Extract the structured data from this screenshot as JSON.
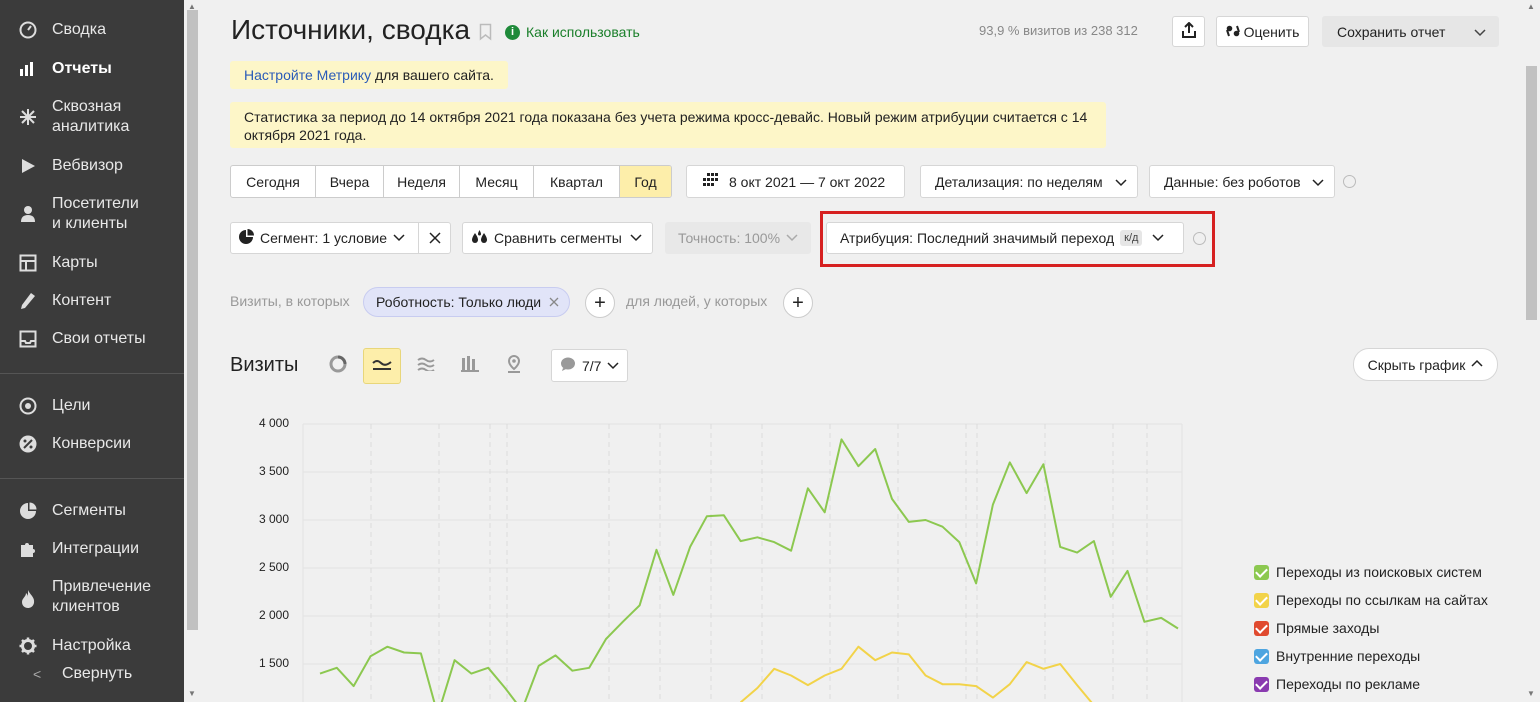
{
  "sidebar": {
    "items": [
      {
        "label": "Сводка",
        "icon": "dashboard-gauge-icon"
      },
      {
        "label": "Отчеты",
        "icon": "bar-chart-icon",
        "active": true
      },
      {
        "label": "Сквозная\nаналитика",
        "icon": "snowflake-icon"
      },
      {
        "label": "Вебвизор",
        "icon": "play-icon"
      },
      {
        "label": "Посетители\nи клиенты",
        "icon": "person-icon"
      },
      {
        "label": "Карты",
        "icon": "map-grid-icon"
      },
      {
        "label": "Контент",
        "icon": "pencil-icon"
      },
      {
        "label": "Свои отчеты",
        "icon": "inbox-icon"
      },
      {
        "label": "Цели",
        "icon": "target-icon"
      },
      {
        "label": "Конверсии",
        "icon": "percent-icon"
      },
      {
        "label": "Сегменты",
        "icon": "pie-icon"
      },
      {
        "label": "Интеграции",
        "icon": "puzzle-icon"
      },
      {
        "label": "Привлечение\nклиентов",
        "icon": "flame-icon"
      },
      {
        "label": "Настройка",
        "icon": "gear-icon"
      }
    ],
    "collapse_label": "Свернуть"
  },
  "header": {
    "title": "Источники, сводка",
    "howto_label": "Как использовать",
    "visits_info": "93,9 % визитов из 238 312",
    "rate_label": "Оценить",
    "save_label": "Сохранить отчет"
  },
  "notices": {
    "setup_link": "Настройте Метрику",
    "setup_rest": " для вашего сайта.",
    "crossdevice": "Статистика за период до 14 октября 2021 года показана без учета режима кросс-девайс. Новый режим атрибуции считается с 14 октября 2021 года."
  },
  "period": {
    "buttons": [
      "Сегодня",
      "Вчера",
      "Неделя",
      "Месяц",
      "Квартал",
      "Год"
    ],
    "active": "Год",
    "date_range": "8 окт 2021 — 7 окт 2022",
    "detail": "Детализация: по неделям",
    "data": "Данные: без роботов"
  },
  "segment": {
    "label": "Сегмент: 1 условие",
    "compare": "Сравнить сегменты",
    "accuracy": "Точность: 100%",
    "attribution": "Атрибуция: Последний значимый переход",
    "attribution_badge": "к/д"
  },
  "filter": {
    "prefix": "Визиты, в которых",
    "chip": "Роботность: Только люди",
    "people": "для людей, у которых"
  },
  "chart_header": {
    "title": "Визиты",
    "series_count": "7/7",
    "hide_label": "Скрыть график"
  },
  "chart_data": {
    "type": "line",
    "ylim": [
      0,
      4000
    ],
    "y_ticks": [
      "4 000",
      "3 500",
      "3 000",
      "2 500",
      "2 000",
      "1 500"
    ],
    "grid": true,
    "legend_position": "right",
    "series": [
      {
        "name": "Переходы из поисковых систем",
        "color": "#8cc850",
        "values": [
          1400,
          1460,
          1270,
          1580,
          1680,
          1620,
          1610,
          970,
          1540,
          1400,
          1460,
          1250,
          1020,
          1480,
          1590,
          1430,
          1460,
          1760,
          1940,
          2110,
          2690,
          2220,
          2720,
          3040,
          3050,
          2780,
          2820,
          2770,
          2680,
          3330,
          3080,
          3840,
          3560,
          3740,
          3220,
          2980,
          3000,
          2930,
          2770,
          2340,
          3160,
          3600,
          3280,
          3580,
          2720,
          2660,
          2780,
          2200,
          2470,
          1940,
          1980,
          1870
        ]
      },
      {
        "name": "Переходы по ссылкам на сайтах",
        "color": "#f2d349",
        "values": [
          null,
          null,
          null,
          null,
          null,
          null,
          null,
          null,
          null,
          null,
          null,
          null,
          null,
          null,
          null,
          null,
          null,
          null,
          null,
          null,
          null,
          null,
          null,
          null,
          null,
          1100,
          1250,
          1450,
          1380,
          1280,
          1380,
          1450,
          1680,
          1540,
          1620,
          1600,
          1380,
          1290,
          1290,
          1270,
          1150,
          1290,
          1520,
          1450,
          1500,
          1280,
          1070,
          null,
          null,
          null,
          null,
          null
        ]
      },
      {
        "name": "Прямые заходы",
        "color": "#e04a2f",
        "values": []
      },
      {
        "name": "Внутренние переходы",
        "color": "#4ea5e0",
        "values": []
      },
      {
        "name": "Переходы по рекламе",
        "color": "#8a3bb0",
        "values": []
      }
    ]
  }
}
